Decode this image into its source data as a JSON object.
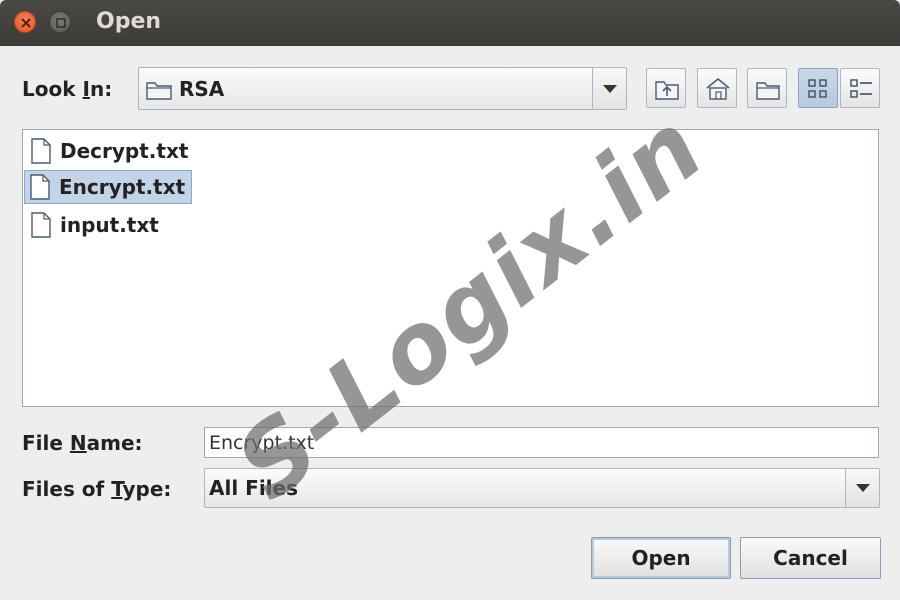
{
  "window": {
    "title": "Open"
  },
  "look_in": {
    "label": "Look In:",
    "label_mnemonic_before": "Look ",
    "label_mnemonic_char": "I",
    "label_mnemonic_after": "n:",
    "value": "RSA",
    "value_icon": "folder-icon"
  },
  "toolbar": {
    "buttons": [
      {
        "name": "up-one-level",
        "icon": "folder-up-icon"
      },
      {
        "name": "home",
        "icon": "home-icon"
      },
      {
        "name": "new-folder",
        "icon": "new-folder-icon"
      },
      {
        "name": "list-view",
        "icon": "list-view-icon",
        "pressed": true
      },
      {
        "name": "details-view",
        "icon": "details-view-icon",
        "pressed": false
      }
    ]
  },
  "files": [
    {
      "name": "Decrypt.txt",
      "icon": "file-icon",
      "selected": false
    },
    {
      "name": "Encrypt.txt",
      "icon": "file-icon",
      "selected": true
    },
    {
      "name": "input.txt",
      "icon": "file-icon",
      "selected": false
    }
  ],
  "file_name": {
    "label_before": "File ",
    "label_mnemonic_char": "N",
    "label_after": "ame:",
    "value": "Encrypt.txt"
  },
  "files_of_type": {
    "label_before": "Files of ",
    "label_mnemonic_char": "T",
    "label_after": "ype:",
    "value": "All Files"
  },
  "buttons": {
    "open": "Open",
    "cancel": "Cancel"
  },
  "watermark": {
    "text": "S-Logix.in"
  },
  "colors": {
    "titlebar": "#3c3b37",
    "close_button": "#e05428",
    "selection": "#c4d4e8",
    "background": "#eeeeee"
  }
}
